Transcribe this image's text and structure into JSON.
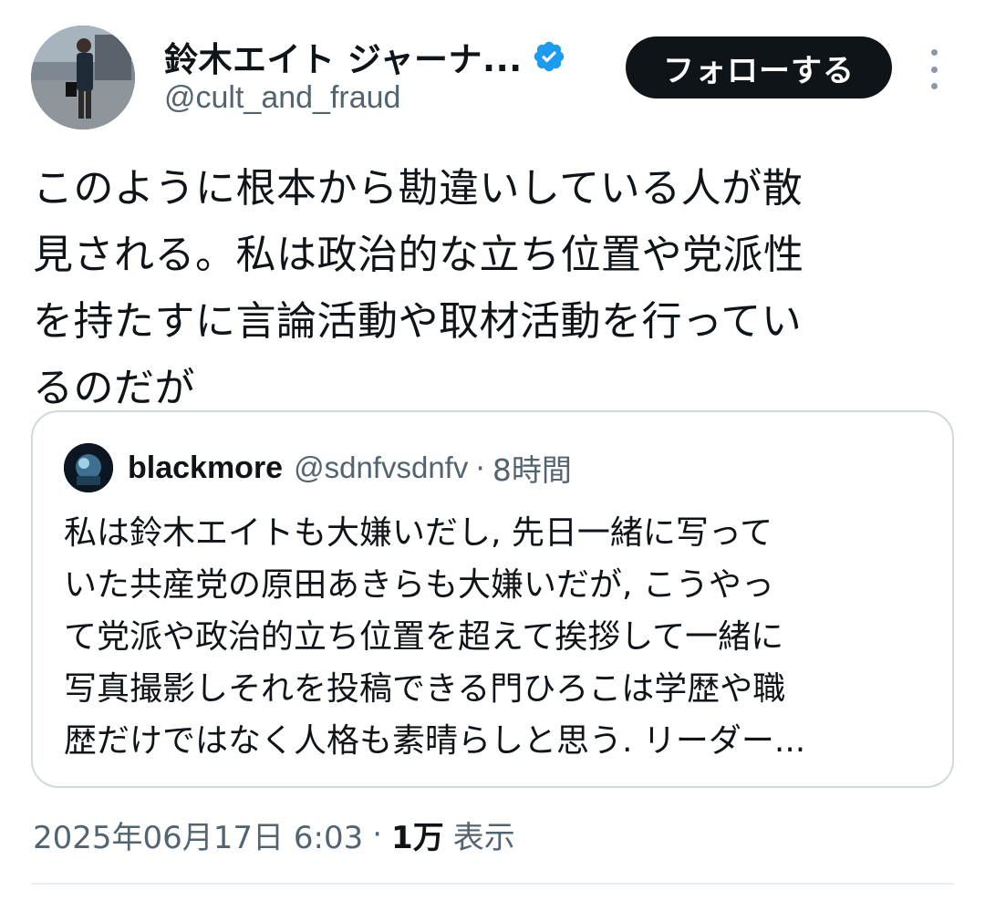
{
  "author": {
    "display_name": "鈴木エイト ジャーナ...",
    "handle": "@cult_and_fraud",
    "verified": true,
    "avatar_icon": "profile-photo"
  },
  "follow_button": {
    "label": "フォローする"
  },
  "more_menu_icon": "more-vertical-icon",
  "tweet": {
    "lines": [
      "このように根本から勘違いしている人が散",
      "見される。私は政治的な立ち位置や党派性",
      "を持たすに言論活動や取材活動を行ってい",
      "るのだが"
    ]
  },
  "quoted_tweet": {
    "display_name": "blackmore",
    "handle": "@sdnfvsdnfv",
    "separator": "·",
    "time": "8時間",
    "lines": [
      "私は鈴木エイトも大嫌いだし, 先日一緒に写って",
      "いた共産党の原田あきらも大嫌いだが, こうやっ",
      "て党派や政治的立ち位置を超えて挨拶して一緒に",
      "写真撮影しそれを投稿できる門ひろこは学歴や職",
      "歴だけではなく人格も素晴らしと思う. リーダー..."
    ]
  },
  "meta": {
    "timestamp": "2025年06月17日 6:03",
    "separator": "·",
    "views_count": "1万",
    "views_label": "表示"
  },
  "colors": {
    "text_primary": "#0f1419",
    "text_secondary": "#536471",
    "verified_badge": "#1d9bf0",
    "follow_button_bg": "#0f1419",
    "border": "#cfd9de"
  }
}
